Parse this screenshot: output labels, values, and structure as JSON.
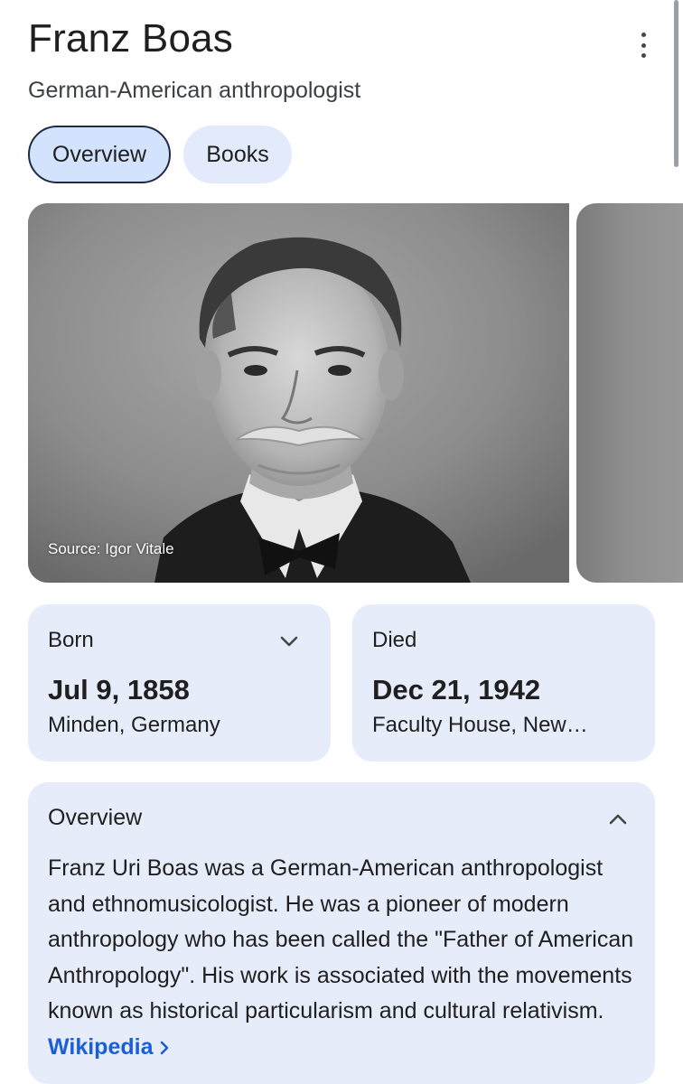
{
  "header": {
    "title": "Franz Boas",
    "subtitle": "German-American anthropologist",
    "more_icon": "more-vert-icon"
  },
  "tabs": [
    {
      "label": "Overview",
      "selected": true
    },
    {
      "label": "Books",
      "selected": false
    }
  ],
  "image": {
    "source": "Source: Igor Vitale",
    "description": "black-and-white portrait photo"
  },
  "facts": {
    "born": {
      "label": "Born",
      "date": "Jul 9, 1858",
      "place": "Minden, Germany",
      "icon": "chevron-down-icon"
    },
    "died": {
      "label": "Died",
      "date": "Dec 21, 1942",
      "place": "Faculty House, New…"
    }
  },
  "overview": {
    "title": "Overview",
    "icon": "chevron-up-icon",
    "text": "Franz Uri Boas was a German-American anthropologist and ethnomusicologist. He was a pioneer of modern anthropology who has been called the \"Father of American Anthropology\". His work is associated with the movements known as historical particularism and cultural relativism.",
    "link_label": "Wikipedia",
    "link_icon": "chevron-right-icon"
  },
  "colors": {
    "card_bg": "#e6ecfa",
    "tab_selected_bg": "#d3e3fd",
    "link": "#1a5fd6"
  }
}
